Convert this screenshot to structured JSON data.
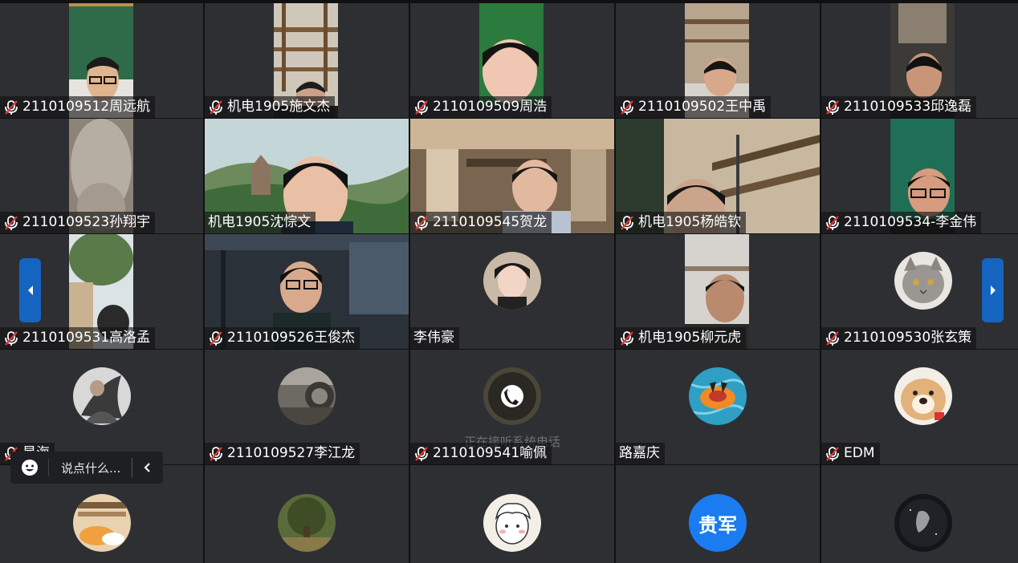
{
  "participants": [
    {
      "name": "2110109512周远航",
      "muted": true
    },
    {
      "name": "机电1905施文杰",
      "muted": true
    },
    {
      "name": "2110109509周浩",
      "muted": true
    },
    {
      "name": "2110109502王中禹",
      "muted": true
    },
    {
      "name": "2110109533邱逸磊",
      "muted": true
    },
    {
      "name": "2110109523孙翔宇",
      "muted": true
    },
    {
      "name": "机电1905沈悰文",
      "muted": false
    },
    {
      "name": "2110109545贺龙",
      "muted": true
    },
    {
      "name": "机电1905杨皓钦",
      "muted": true
    },
    {
      "name": "2110109534-李金伟",
      "muted": true
    },
    {
      "name": "2110109531高洛孟",
      "muted": true
    },
    {
      "name": "2110109526王俊杰",
      "muted": true
    },
    {
      "name": "李伟豪",
      "muted": false
    },
    {
      "name": "机电1905柳元虎",
      "muted": true
    },
    {
      "name": "2110109530张玄策",
      "muted": true
    },
    {
      "name": "晁海",
      "muted": true
    },
    {
      "name": "2110109527李江龙",
      "muted": true
    },
    {
      "name": "2110109541喻佩",
      "muted": true,
      "status": "正在接听系统电话"
    },
    {
      "name": "路嘉庆",
      "muted": false
    },
    {
      "name": "EDM",
      "muted": true
    },
    {
      "avatar_text": "贵军"
    }
  ],
  "chat": {
    "placeholder": "说点什么..."
  },
  "icons": {
    "muted_mic": "mic-muted-icon",
    "phone": "phone-icon",
    "emoji": "emoji-icon",
    "collapse": "chevron-left-icon",
    "page_prev": "chevron-left-icon",
    "page_next": "chevron-right-icon"
  },
  "colors": {
    "tile_background": "#2d2f33",
    "muted_red": "#e53935",
    "page_button": "#1565c0",
    "avatar_blue": "#1b7cf2"
  }
}
